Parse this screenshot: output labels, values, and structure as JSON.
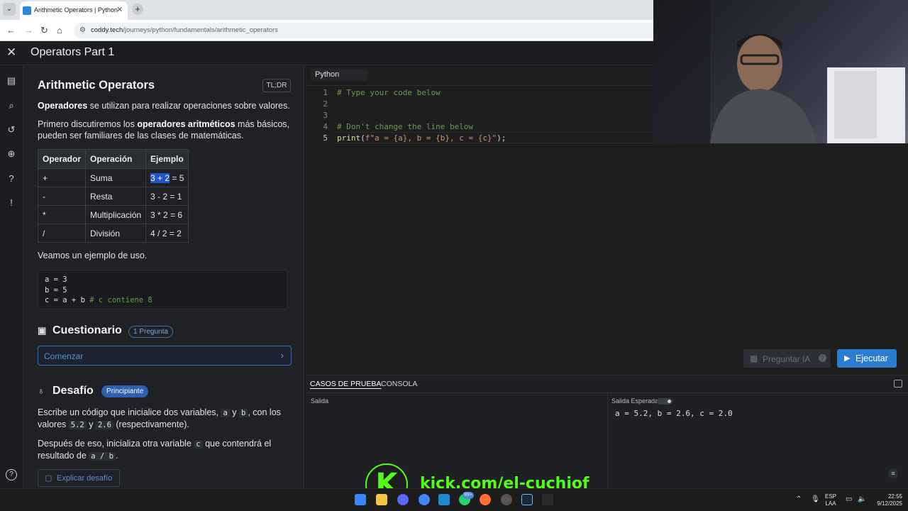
{
  "browser": {
    "tab_title": "Arithmetic Operators | Python",
    "url_host": "coddy.tech",
    "url_path": "/journeys/python/fundamentals/arithmetic_operators"
  },
  "header": {
    "title": "Operators Part 1"
  },
  "lesson": {
    "title": "Arithmetic Operators",
    "tldr": "TL;DR",
    "intro_bold": "Operadores",
    "intro_rest": " se utilizan para realizar operaciones sobre valores.",
    "p2_a": "Primero discutiremos los ",
    "p2_bold": "operadores aritméticos",
    "p2_b": " más básicos, pueden ser familiares de las clases de matemáticas.",
    "table": {
      "headers": [
        "Operador",
        "Operación",
        "Ejemplo"
      ],
      "rows": [
        {
          "op": "+",
          "name": "Suma",
          "ex_hl": "3 + 2",
          "ex_rest": " = 5"
        },
        {
          "op": "-",
          "name": "Resta",
          "ex": "3 - 2 = 1"
        },
        {
          "op": "*",
          "name": "Multiplicación",
          "ex": "3 * 2 = 6"
        },
        {
          "op": "/",
          "name": "División",
          "ex": "4 / 2 = 2"
        }
      ]
    },
    "example_intro": "Veamos un ejemplo de uso.",
    "example_code": {
      "l1": "a = 3",
      "l2": "b = 5",
      "l3": "c = a + b ",
      "l3_comment": "# c contiene 8"
    }
  },
  "quiz": {
    "title": "Cuestionario",
    "badge": "1 Pregunta",
    "start_label": "Comenzar"
  },
  "challenge": {
    "title": "Desafío",
    "badge": "Principiante",
    "p1_a": "Escribe un código que inicialice dos variables, ",
    "var_a": "a",
    "p1_y": " y ",
    "var_b": "b",
    "p1_b": ", con los valores ",
    "val_a": "5.2",
    "p1_y2": " y ",
    "val_b": "2.6",
    "p1_c": " (respectivamente).",
    "p2_a": "Después de eso, inicializa otra variable ",
    "var_c": "c",
    "p2_b": " que contendrá el resultado de ",
    "expr": "a / b",
    "p2_c": ".",
    "explain_label": "Explicar desafío"
  },
  "editor": {
    "language": "Python",
    "line_numbers": [
      "1",
      "2",
      "3",
      "4",
      "5"
    ],
    "line1": "# Type your code below",
    "line4": "# Don't change the line below",
    "line5_fn": "print",
    "line5_open": "(",
    "line5_str": "f\"a = {a}, b = {b}, c = {c}\"",
    "line5_close": ");",
    "ask_label": "Preguntar IA",
    "run_label": "Ejecutar"
  },
  "tests": {
    "tab_cases": "CASOS DE PRUEBA",
    "tab_console": "CONSOLA",
    "output_label": "Salida",
    "expected_label": "Salida Esperada",
    "expected_value": "a = 5.2, b = 2.6, c = 2.0"
  },
  "overlay": {
    "kick_text": "kick.com/el-cuchiof",
    "kick_letter": "K"
  },
  "taskbar": {
    "lang": "ESP",
    "lang2": "LAA",
    "time": "22:55",
    "date": "9/12/2025",
    "badge": "99+"
  },
  "colors": {
    "accent": "#2c7cd0",
    "kick_green": "#53fc18",
    "highlight": "#2256c5"
  }
}
